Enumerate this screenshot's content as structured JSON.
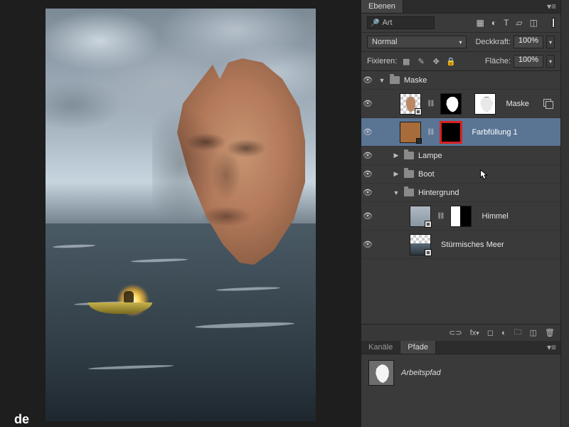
{
  "panel": {
    "tab_layers": "Ebenen"
  },
  "search": {
    "placeholder": "Art"
  },
  "blend": {
    "mode": "Normal",
    "opacity_label": "Deckkraft:",
    "opacity_value": "100%",
    "fill_label": "Fläche:",
    "fill_value": "100%"
  },
  "lock": {
    "label": "Fixieren:"
  },
  "layers": {
    "group_maske": "Maske",
    "layer_maske": "Maske",
    "layer_fill": "Farbfüllung 1",
    "group_lampe": "Lampe",
    "group_boot": "Boot",
    "group_hintergrund": "Hintergrund",
    "layer_himmel": "Himmel",
    "layer_meer": "Stürmisches Meer"
  },
  "paths": {
    "tab_kanaele": "Kanäle",
    "tab_pfade": "Pfade",
    "workpath": "Arbeitspfad"
  },
  "watermark": "de"
}
